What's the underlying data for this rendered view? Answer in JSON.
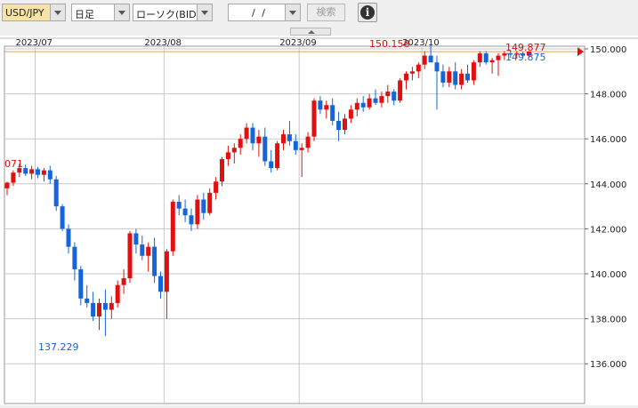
{
  "toolbar": {
    "symbol": "USD/JPY",
    "interval": "日足",
    "chart_style": "ローソク(BID)",
    "date_value": "/ /",
    "search_label": "検索",
    "info_glyph": "i"
  },
  "colors": {
    "up": "#e01010",
    "down": "#1565d8",
    "grid": "#c8c8c8",
    "current_line": "#e0a060"
  },
  "chart_data": {
    "type": "candlestick",
    "symbol": "USD/JPY",
    "x_labels": [
      "2023/07",
      "2023/08",
      "2023/09",
      "2023/10"
    ],
    "y_ticks": [
      "150.000",
      "148.000",
      "146.000",
      "144.000",
      "142.000",
      "140.000",
      "138.000",
      "136.000"
    ],
    "ylim": [
      136.0,
      151.0
    ],
    "annotations": {
      "high": "150.158",
      "low": "137.229",
      "left_partial": "071",
      "current_ask": "149.877",
      "current_bid": "149.875"
    },
    "current_price": 149.877,
    "month_starts": [
      5,
      26,
      48,
      68
    ],
    "candles": [
      [
        143.8,
        144.1,
        143.5,
        144.05
      ],
      [
        144.05,
        144.6,
        143.9,
        144.5
      ],
      [
        144.5,
        144.9,
        144.3,
        144.7
      ],
      [
        144.7,
        144.85,
        144.35,
        144.45
      ],
      [
        144.45,
        144.8,
        144.2,
        144.65
      ],
      [
        144.65,
        144.75,
        144.25,
        144.4
      ],
      [
        144.4,
        144.7,
        144.1,
        144.6
      ],
      [
        144.6,
        144.8,
        144.0,
        144.2
      ],
      [
        144.2,
        144.35,
        142.8,
        143.0
      ],
      [
        143.0,
        143.1,
        141.9,
        142.0
      ],
      [
        142.0,
        142.2,
        140.9,
        141.2
      ],
      [
        141.2,
        141.4,
        139.7,
        140.2
      ],
      [
        140.2,
        140.35,
        138.6,
        138.9
      ],
      [
        138.9,
        139.5,
        138.5,
        138.7
      ],
      [
        138.7,
        139.2,
        137.9,
        138.1
      ],
      [
        138.1,
        138.9,
        137.5,
        138.7
      ],
      [
        138.7,
        139.3,
        137.23,
        138.4
      ],
      [
        138.4,
        139.0,
        138.0,
        138.7
      ],
      [
        138.7,
        139.7,
        138.5,
        139.5
      ],
      [
        139.5,
        140.2,
        139.1,
        139.8
      ],
      [
        139.8,
        141.9,
        139.6,
        141.8
      ],
      [
        141.8,
        142.0,
        140.9,
        141.3
      ],
      [
        141.3,
        141.7,
        140.6,
        140.8
      ],
      [
        140.8,
        141.4,
        140.1,
        141.2
      ],
      [
        141.2,
        141.6,
        139.6,
        139.9
      ],
      [
        139.9,
        140.1,
        138.9,
        139.2
      ],
      [
        139.2,
        141.1,
        138.0,
        141.0
      ],
      [
        141.0,
        143.3,
        140.8,
        143.2
      ],
      [
        143.2,
        143.5,
        142.6,
        142.9
      ],
      [
        142.9,
        143.3,
        142.3,
        142.6
      ],
      [
        142.6,
        142.9,
        141.9,
        142.2
      ],
      [
        142.2,
        143.5,
        142.0,
        143.3
      ],
      [
        143.3,
        143.6,
        142.4,
        142.7
      ],
      [
        142.7,
        143.8,
        142.6,
        143.6
      ],
      [
        143.6,
        144.3,
        143.3,
        144.1
      ],
      [
        144.1,
        145.2,
        143.9,
        145.1
      ],
      [
        145.1,
        145.7,
        144.8,
        145.4
      ],
      [
        145.4,
        145.8,
        144.9,
        145.6
      ],
      [
        145.6,
        146.2,
        145.3,
        146.0
      ],
      [
        146.0,
        146.7,
        145.8,
        146.5
      ],
      [
        146.5,
        146.7,
        145.5,
        145.8
      ],
      [
        145.8,
        146.4,
        145.2,
        146.1
      ],
      [
        146.1,
        146.5,
        144.8,
        145.0
      ],
      [
        145.0,
        145.5,
        144.5,
        144.7
      ],
      [
        144.7,
        145.9,
        144.6,
        145.8
      ],
      [
        145.8,
        146.4,
        145.5,
        146.2
      ],
      [
        146.2,
        146.8,
        145.7,
        145.9
      ],
      [
        145.9,
        146.2,
        145.3,
        145.5
      ],
      [
        145.5,
        145.8,
        144.3,
        145.6
      ],
      [
        145.6,
        146.3,
        145.4,
        146.1
      ],
      [
        146.1,
        147.8,
        145.9,
        147.7
      ],
      [
        147.7,
        147.9,
        147.1,
        147.3
      ],
      [
        147.3,
        147.7,
        146.9,
        147.5
      ],
      [
        147.5,
        147.8,
        146.6,
        146.8
      ],
      [
        146.8,
        147.2,
        145.9,
        146.4
      ],
      [
        146.4,
        147.1,
        146.2,
        146.9
      ],
      [
        146.9,
        147.5,
        146.7,
        147.3
      ],
      [
        147.3,
        147.8,
        147.0,
        147.6
      ],
      [
        147.6,
        147.9,
        147.2,
        147.4
      ],
      [
        147.4,
        148.0,
        147.3,
        147.8
      ],
      [
        147.8,
        148.2,
        147.5,
        147.6
      ],
      [
        147.6,
        148.1,
        147.4,
        147.9
      ],
      [
        147.9,
        148.4,
        147.6,
        148.1
      ],
      [
        148.1,
        148.2,
        147.5,
        147.7
      ],
      [
        147.7,
        148.7,
        147.6,
        148.6
      ],
      [
        148.6,
        149.0,
        148.2,
        148.9
      ],
      [
        148.9,
        149.2,
        148.6,
        149.0
      ],
      [
        149.0,
        149.4,
        148.7,
        149.3
      ],
      [
        149.3,
        149.9,
        149.1,
        149.7
      ],
      [
        149.7,
        150.16,
        149.5,
        149.4
      ],
      [
        149.4,
        149.7,
        147.3,
        149.0
      ],
      [
        149.0,
        149.3,
        148.3,
        148.5
      ],
      [
        148.5,
        149.2,
        148.3,
        149.0
      ],
      [
        149.0,
        149.4,
        148.2,
        148.4
      ],
      [
        148.4,
        149.1,
        148.2,
        148.9
      ],
      [
        148.9,
        149.3,
        148.5,
        148.6
      ],
      [
        148.6,
        149.5,
        148.4,
        149.4
      ],
      [
        149.4,
        149.9,
        149.2,
        149.8
      ],
      [
        149.8,
        149.9,
        149.3,
        149.4
      ],
      [
        149.4,
        149.6,
        148.9,
        149.5
      ],
      [
        149.5,
        149.8,
        148.8,
        149.7
      ],
      [
        149.7,
        149.9,
        149.5,
        149.8
      ],
      [
        149.8,
        149.95,
        149.6,
        149.75
      ],
      [
        149.75,
        149.9,
        149.6,
        149.8
      ],
      [
        149.8,
        149.88,
        149.65,
        149.7
      ],
      [
        149.7,
        149.9,
        149.6,
        149.88
      ]
    ]
  }
}
